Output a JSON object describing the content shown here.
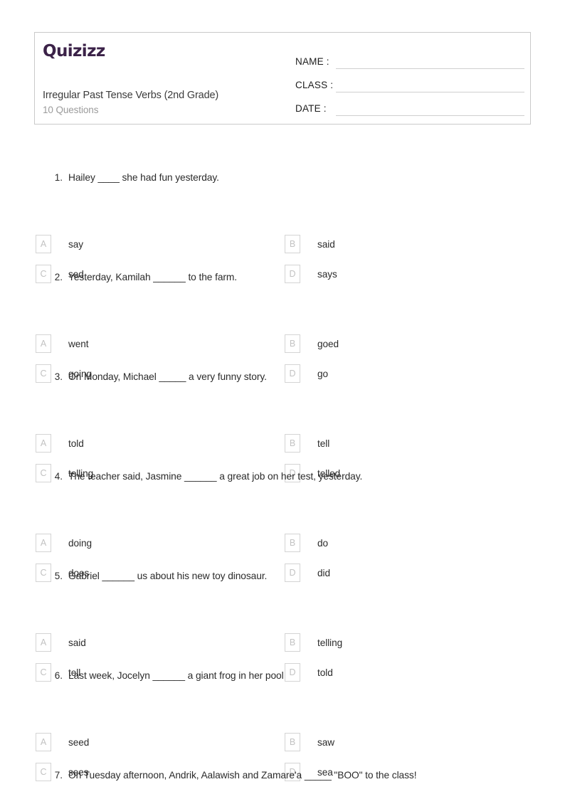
{
  "brand": {
    "logo_text": "Quizizz",
    "logo_color": "#3b2248"
  },
  "header": {
    "title": "Irregular Past Tense Verbs (2nd Grade)",
    "subtitle": "10 Questions",
    "fields": [
      {
        "label": "NAME :",
        "value": ""
      },
      {
        "label": "CLASS :",
        "value": ""
      },
      {
        "label": "DATE  :",
        "value": ""
      }
    ]
  },
  "questions": [
    {
      "number": "1.",
      "text": "Hailey ____ she had fun yesterday.",
      "options": [
        {
          "letter": "A",
          "text": "say"
        },
        {
          "letter": "B",
          "text": "said"
        },
        {
          "letter": "C",
          "text": "sed"
        },
        {
          "letter": "D",
          "text": "says"
        }
      ]
    },
    {
      "number": "2.",
      "text": "Yesterday, Kamilah ______ to the farm.",
      "options": [
        {
          "letter": "A",
          "text": "went"
        },
        {
          "letter": "B",
          "text": "goed"
        },
        {
          "letter": "C",
          "text": "going"
        },
        {
          "letter": "D",
          "text": "go"
        }
      ]
    },
    {
      "number": "3.",
      "text": "On Monday, Michael _____ a very funny story.",
      "options": [
        {
          "letter": "A",
          "text": "told"
        },
        {
          "letter": "B",
          "text": "tell"
        },
        {
          "letter": "C",
          "text": "telling"
        },
        {
          "letter": "D",
          "text": "telled"
        }
      ]
    },
    {
      "number": "4.",
      "text": "The teacher said, Jasmine ______ a great job on her test, yesterday.",
      "options": [
        {
          "letter": "A",
          "text": "doing"
        },
        {
          "letter": "B",
          "text": "do"
        },
        {
          "letter": "C",
          "text": "does"
        },
        {
          "letter": "D",
          "text": "did"
        }
      ]
    },
    {
      "number": "5.",
      "text": "Gabriel ______ us about his new toy dinosaur.",
      "options": [
        {
          "letter": "A",
          "text": "said"
        },
        {
          "letter": "B",
          "text": "telling"
        },
        {
          "letter": "C",
          "text": "tell"
        },
        {
          "letter": "D",
          "text": "told"
        }
      ]
    },
    {
      "number": "6.",
      "text": "Last week, Jocelyn ______ a giant frog in her pool",
      "options": [
        {
          "letter": "A",
          "text": "seed"
        },
        {
          "letter": "B",
          "text": "saw"
        },
        {
          "letter": "C",
          "text": "sees"
        },
        {
          "letter": "D",
          "text": "sea"
        }
      ]
    },
    {
      "number": "7.",
      "text": "On Tuesday afternoon, Andrik, Aalawish and Zamare'a _____ \"BOO\" to the class!",
      "options": []
    }
  ]
}
